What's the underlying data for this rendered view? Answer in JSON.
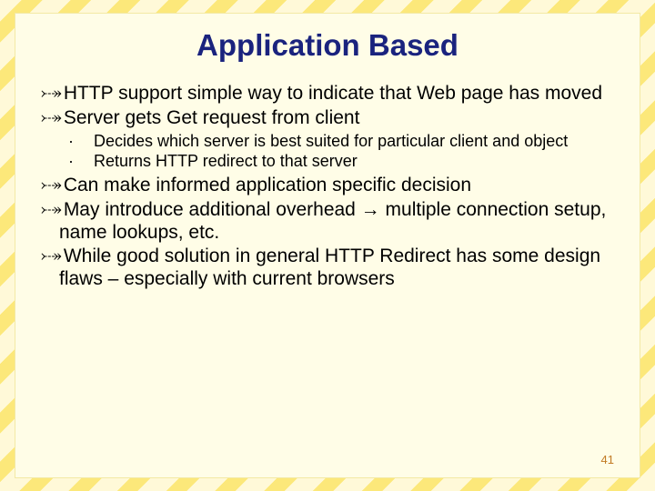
{
  "slide": {
    "title": "Application Based",
    "bullets": {
      "b0": "HTTP support simple way to indicate that Web page has moved",
      "b1": "Server gets Get request from client",
      "b1_sub": {
        "s0": "Decides which server is best suited for particular client and object",
        "s1": "Returns HTTP redirect to that server"
      },
      "b2": "Can make informed application specific decision",
      "b3": "May introduce additional overhead → multiple connection setup, name lookups, etc.",
      "b4": "While good solution in general HTTP Redirect has some design flaws – especially with current browsers"
    },
    "page_number": "41"
  }
}
